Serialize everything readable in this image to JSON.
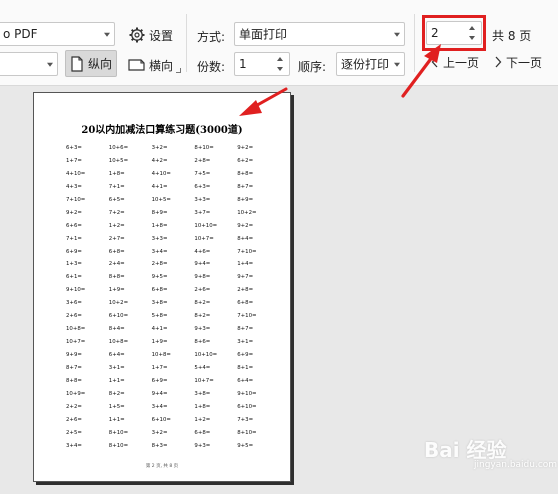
{
  "toolbar": {
    "printer_value": "o PDF",
    "settings_label": "设置",
    "portrait_label": "纵向",
    "landscape_label": "横向",
    "mode_label": "方式:",
    "mode_value": "单面打印",
    "copies_label": "份数:",
    "copies_value": "1",
    "order_label": "顺序:",
    "order_value": "逐份打印",
    "page_value": "2",
    "total_pages": "共 8 页",
    "prev_label": "上一页",
    "next_label": "下一页"
  },
  "document": {
    "title": "20以内加减法口算练习题(3000道)",
    "footer": "第 2 页, 共 8 页",
    "problems": [
      "6+3=",
      "10+6=",
      "3+2=",
      "8+10=",
      "9+2=",
      "1+7=",
      "10+5=",
      "4+2=",
      "2+8=",
      "6+2=",
      "4+10=",
      "1+8=",
      "4+10=",
      "7+5=",
      "8+8=",
      "4+3=",
      "7+1=",
      "4+1=",
      "6+3=",
      "8+7=",
      "7+10=",
      "6+5=",
      "10+5=",
      "3+3=",
      "8+9=",
      "9+2=",
      "7+2=",
      "8+9=",
      "3+7=",
      "10+2=",
      "6+6=",
      "1+2=",
      "1+8=",
      "10+10=",
      "9+2=",
      "7+1=",
      "2+7=",
      "3+3=",
      "10+7=",
      "8+4=",
      "6+9=",
      "6+8=",
      "3+4=",
      "4+6=",
      "7+10=",
      "1+3=",
      "2+4=",
      "2+8=",
      "9+4=",
      "1+4=",
      "6+1=",
      "8+8=",
      "9+5=",
      "9+8=",
      "9+7=",
      "9+10=",
      "1+9=",
      "6+8=",
      "2+6=",
      "2+8=",
      "3+6=",
      "10+2=",
      "3+8=",
      "8+2=",
      "6+8=",
      "2+6=",
      "6+10=",
      "5+8=",
      "8+2=",
      "7+10=",
      "10+8=",
      "8+4=",
      "4+1=",
      "9+3=",
      "8+7=",
      "10+7=",
      "10+8=",
      "1+9=",
      "8+6=",
      "3+1=",
      "9+9=",
      "6+4=",
      "10+8=",
      "10+10=",
      "6+9=",
      "8+7=",
      "3+1=",
      "1+7=",
      "5+4=",
      "8+1=",
      "8+8=",
      "1+1=",
      "6+9=",
      "10+7=",
      "6+4=",
      "10+9=",
      "8+2=",
      "9+4=",
      "3+8=",
      "9+10=",
      "2+2=",
      "1+5=",
      "3+4=",
      "1+8=",
      "6+10=",
      "2+6=",
      "1+1=",
      "6+10=",
      "1+2=",
      "7+3=",
      "2+5=",
      "8+10=",
      "3+2=",
      "6+8=",
      "8+10=",
      "3+4=",
      "8+10=",
      "8+3=",
      "9+3=",
      "9+5="
    ]
  },
  "watermark": {
    "text": "Bai 经验",
    "sub": "jingyan.baidu.com"
  }
}
